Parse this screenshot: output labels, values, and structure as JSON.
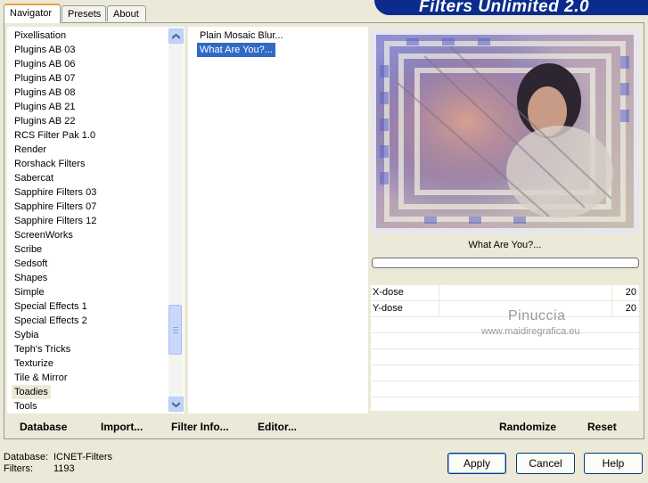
{
  "banner": {
    "title": "Filters Unlimited 2.0"
  },
  "tabs": [
    {
      "label": "Navigator",
      "active": true
    },
    {
      "label": "Presets",
      "active": false
    },
    {
      "label": "About",
      "active": false
    }
  ],
  "categories": [
    "Pixellisation",
    "Plugins AB 03",
    "Plugins AB 06",
    "Plugins AB 07",
    "Plugins AB 08",
    "Plugins AB 21",
    "Plugins AB 22",
    "RCS Filter Pak 1.0",
    "Render",
    "Rorshack Filters",
    "Sabercat",
    "Sapphire Filters 03",
    "Sapphire Filters 07",
    "Sapphire Filters 12",
    "ScreenWorks",
    "Scribe",
    "Sedsoft",
    "Shapes",
    "Simple",
    "Special Effects 1",
    "Special Effects 2",
    "Sybia",
    "Teph's Tricks",
    "Texturize",
    "Tile & Mirror",
    "Toadies",
    "Tools"
  ],
  "selected_category": "Toadies",
  "filters": [
    "Plain Mosaic Blur...",
    "What Are You?..."
  ],
  "selected_filter": "What Are You?...",
  "toolbar": {
    "database": "Database",
    "import": "Import...",
    "filter_info": "Filter Info...",
    "editor": "Editor...",
    "randomize": "Randomize",
    "reset": "Reset"
  },
  "preview": {
    "filter_name": "What Are You?...",
    "watermark_name": "Pinuccia",
    "watermark_url": "www.maidiregrafica.eu"
  },
  "params": [
    {
      "label": "X-dose",
      "value": "20"
    },
    {
      "label": "Y-dose",
      "value": "20"
    }
  ],
  "status": {
    "database_label": "Database:",
    "database_value": "ICNET-Filters",
    "filters_label": "Filters:",
    "filters_value": "1193"
  },
  "buttons": {
    "apply": "Apply",
    "cancel": "Cancel",
    "help": "Help"
  },
  "colors": {
    "selection": "#316ac5",
    "banner": "#0b2c8c"
  }
}
